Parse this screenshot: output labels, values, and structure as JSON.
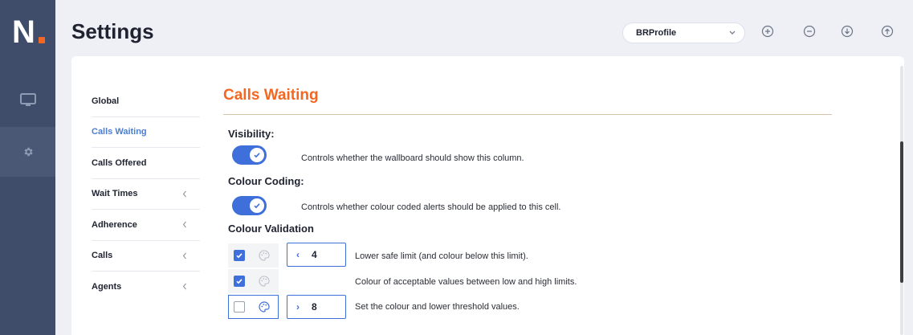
{
  "app": {
    "logo_letter": "N",
    "accent": "#f26722",
    "primary": "#3f6fda",
    "rail_bg": "#3f4d6b"
  },
  "rail": {
    "items": [
      {
        "icon": "monitor-icon"
      },
      {
        "icon": "gear-icon",
        "active": true
      }
    ]
  },
  "header": {
    "title": "Settings",
    "profile_select": {
      "value": "BRProfile"
    },
    "actions": [
      {
        "icon": "add-circle-icon"
      },
      {
        "icon": "remove-circle-icon"
      },
      {
        "icon": "download-circle-icon"
      },
      {
        "icon": "upload-circle-icon"
      }
    ]
  },
  "sidebar": {
    "items": [
      {
        "label": "Global",
        "expandable": false,
        "active": false
      },
      {
        "label": "Calls Waiting",
        "expandable": false,
        "active": true
      },
      {
        "label": "Calls Offered",
        "expandable": false,
        "active": false
      },
      {
        "label": "Wait Times",
        "expandable": true,
        "active": false
      },
      {
        "label": "Adherence",
        "expandable": true,
        "active": false
      },
      {
        "label": "Calls",
        "expandable": true,
        "active": false
      },
      {
        "label": "Agents",
        "expandable": true,
        "active": false
      }
    ]
  },
  "content": {
    "title": "Calls Waiting",
    "visibility": {
      "label": "Visibility:",
      "enabled": true,
      "description": "Controls whether the wallboard should show this column."
    },
    "colour_coding": {
      "label": "Colour Coding:",
      "enabled": true,
      "description": "Controls whether colour coded alerts should be applied to this cell."
    },
    "colour_validation": {
      "label": "Colour Validation",
      "rows": [
        {
          "checked": true,
          "direction": "‹",
          "value": "4",
          "description": "Lower safe limit (and colour below this limit)."
        },
        {
          "checked": true,
          "description": "Colour of acceptable values between low and high limits."
        },
        {
          "checked": false,
          "direction": "›",
          "value": "8",
          "description": "Set the colour and lower threshold values."
        }
      ]
    }
  }
}
